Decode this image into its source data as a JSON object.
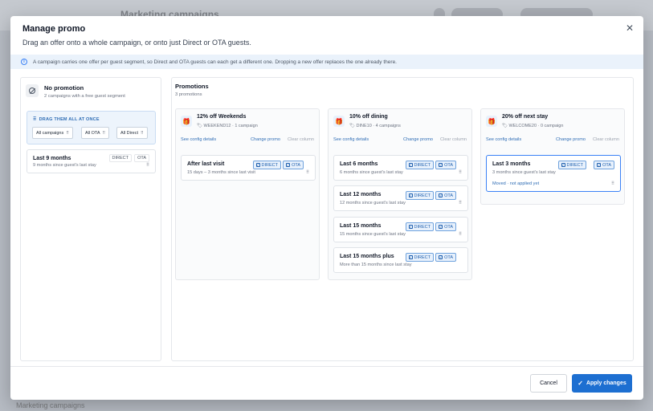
{
  "background": {
    "app_title": "Marketing campaigns",
    "footer_text": "Marketing campaigns"
  },
  "modal": {
    "title": "Manage promo",
    "subtitle": "Drag an offer onto a whole campaign, or onto just Direct or OTA guests.",
    "close_icon": "close-icon",
    "info_banner": "A campaign carries one offer per guest segment, so Direct and OTA guests can each get a different one. Dropping a new offer replaces the one already there."
  },
  "left": {
    "no_promo_title": "No promotion",
    "no_promo_sub": "2 campaigns with a free guest segment",
    "drag_label": "DRAG THEM ALL AT ONCE",
    "drag_chips": [
      "All campaigns",
      "All OTA",
      "All Direct"
    ],
    "segment": {
      "title": "Last 9 months",
      "tags": [
        "DIRECT",
        "OTA"
      ],
      "sub": "9 months since guest's last stay",
      "grip": "⠿"
    }
  },
  "promotions": {
    "header": "Promotions",
    "count": "3 promotions",
    "columns": [
      {
        "title": "12% off Weekends",
        "code": "WEEKEND12 · 1 campaign",
        "config_link": "See config details",
        "change_link": "Change promo",
        "clear_link": "Clear column",
        "segments": [
          {
            "title": "After last visit",
            "tags": [
              "DIRECT",
              "OTA"
            ],
            "sub": "15 days – 3 months since last visit"
          }
        ]
      },
      {
        "title": "10% off dining",
        "code": "DINE10 · 4 campaigns",
        "config_link": "See config details",
        "change_link": "Change promo",
        "clear_link": "Clear column",
        "segments": [
          {
            "title": "Last 6 months",
            "tags": [
              "DIRECT",
              "OTA"
            ],
            "sub": "6 months since guest's last stay"
          },
          {
            "title": "Last 12 months",
            "tags": [
              "DIRECT",
              "OTA"
            ],
            "sub": "12 months since guest's last stay"
          },
          {
            "title": "Last 15 months",
            "tags": [
              "DIRECT",
              "OTA"
            ],
            "sub": "15 months since guest's last stay"
          },
          {
            "title": "Last 15 months plus",
            "tags": [
              "DIRECT",
              "OTA"
            ],
            "sub": "More than 15 months since last stay"
          }
        ]
      },
      {
        "title": "20% off next stay",
        "code": "WELCOME20 · 0 campaign",
        "config_link": "See config details",
        "change_link": "Change promo",
        "clear_link": "Clear column",
        "segments": [
          {
            "title": "Last 3 months",
            "tags": [
              "DIRECT",
              "OTA"
            ],
            "sub": "3 months since guest's last stay",
            "note": "Moved · not applied yet"
          }
        ]
      }
    ]
  },
  "footer": {
    "cancel": "Cancel",
    "apply": "Apply changes"
  },
  "colors": {
    "accent": "#1d6fd1",
    "banner": "#eaf2fb",
    "tag_bg": "#e8f1fc"
  }
}
